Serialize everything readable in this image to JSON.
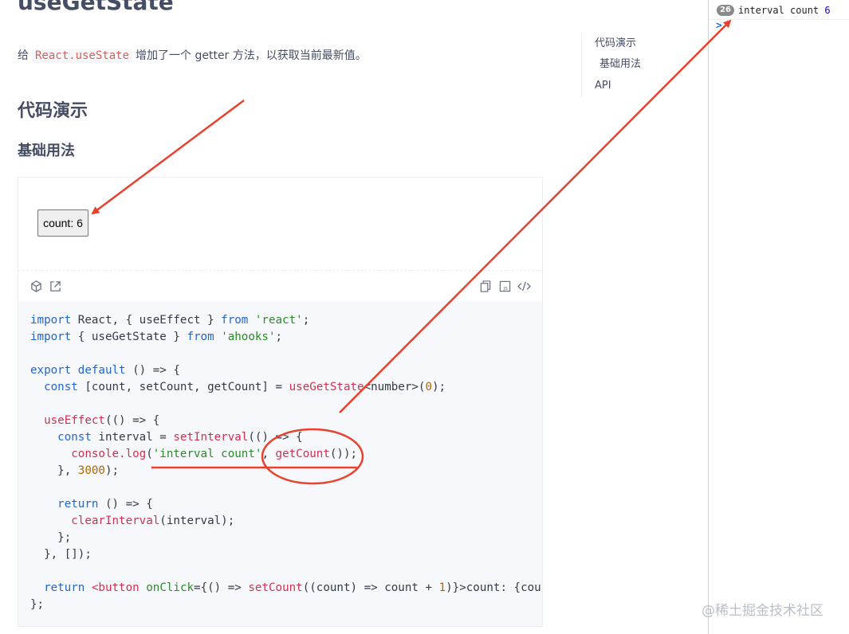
{
  "page": {
    "title": "useGetState",
    "intro_before": "给",
    "intro_code": "React.useState",
    "intro_after": "增加了一个 getter 方法，以获取当前最新值。",
    "section_heading": "代码演示",
    "subsection_heading": "基础用法"
  },
  "toc": {
    "items": [
      {
        "label": "代码演示"
      },
      {
        "label": "基础用法"
      },
      {
        "label": "API"
      }
    ]
  },
  "demo": {
    "button_label": "count: 6",
    "toolbar_icons": [
      "codesandbox-icon",
      "external-link-icon",
      "copy-icon",
      "js-icon",
      "code-icon"
    ]
  },
  "devtools": {
    "log_count": "26",
    "log_message": "interval count",
    "log_value": "6",
    "prompt": ">"
  },
  "watermark": "@稀土掘金技术社区",
  "colors": {
    "annotation": "#e8412c",
    "link": "#2266cc",
    "inline_code": "#d56161"
  }
}
